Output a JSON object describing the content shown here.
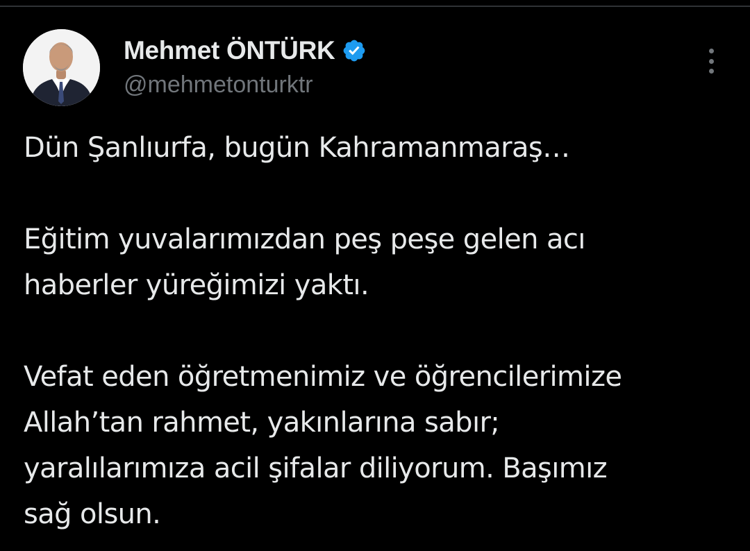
{
  "tweet": {
    "author": {
      "display_name": "Mehmet ÖNTÜRK",
      "handle": "@mehmetonturktr",
      "verified": true,
      "avatar_icon": "profile-photo"
    },
    "more_icon": "more-vertical-icon",
    "body": {
      "paragraphs": [
        [
          "Dün Şanlıurfa, bugün Kahramanmaraş…"
        ],
        [
          "Eğitim yuvalarımızdan peş peşe gelen acı",
          "haberler yüreğimizi yaktı."
        ],
        [
          "Vefat eden öğretmenimiz ve öğrencilerimize",
          "Allah’tan rahmet, yakınlarına sabır;",
          "yaralılarımıza acil şifalar diliyorum. Başımız",
          "sağ olsun."
        ]
      ]
    }
  },
  "colors": {
    "background": "#000000",
    "text": "#e7e9ea",
    "secondary_text": "#71767b",
    "verified_badge": "#1d9bf0"
  }
}
